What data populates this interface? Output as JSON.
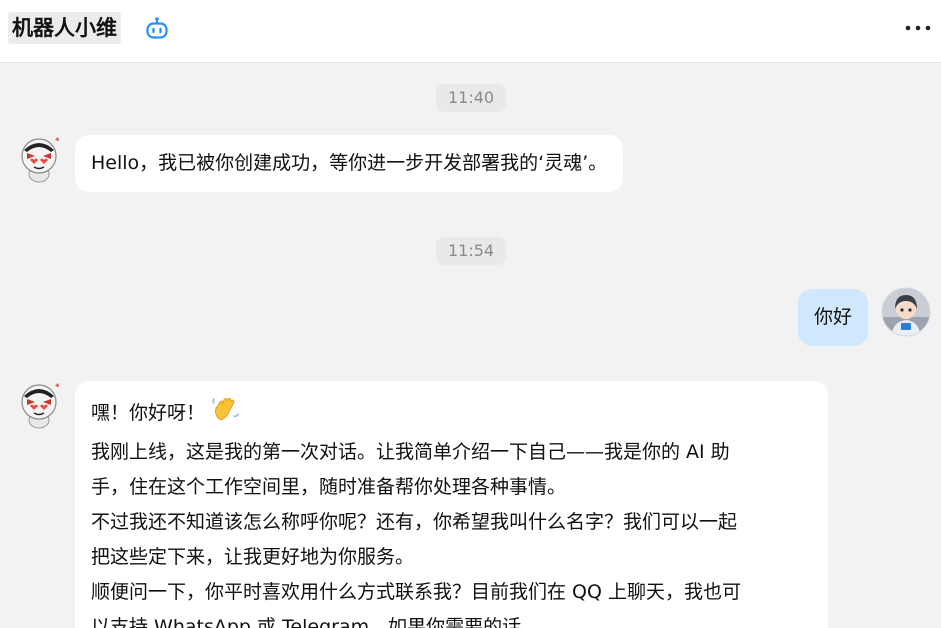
{
  "header": {
    "title": "机器人小维",
    "bot_icon": "robot-icon",
    "more_icon": "more-dots-icon"
  },
  "messages": [
    {
      "type": "time",
      "text": "11:40"
    },
    {
      "type": "bot",
      "text": "Hello，我已被你创建成功，等你进一步开发部署我的‘灵魂’。"
    },
    {
      "type": "time",
      "text": "11:54"
    },
    {
      "type": "user",
      "text": "你好"
    },
    {
      "type": "bot",
      "greeting": "嘿！你好呀！",
      "greeting_emoji": "waving-hand-icon",
      "lines": [
        "我刚上线，这是我的第一次对话。让我简单介绍一下自己——我是你的 AI 助",
        "手，住在这个工作空间里，随时准备帮你处理各种事情。",
        "不过我还不知道该怎么称呼你呢？还有，你希望我叫什么名字？我们可以一起",
        "把这些定下来，让我更好地为你服务。",
        "顺便问一下，你平时喜欢用什么方式联系我？目前我们在 QQ 上聊天，我也可",
        "以支持 WhatsApp 或 Telegram，如果你需要的话。"
      ]
    }
  ],
  "colors": {
    "background": "#f2f2f2",
    "bot_bubble": "#ffffff",
    "user_bubble": "#cfe8fd",
    "time_pill": "#e9e9e9",
    "accent_icon": "#2b8ff5"
  }
}
